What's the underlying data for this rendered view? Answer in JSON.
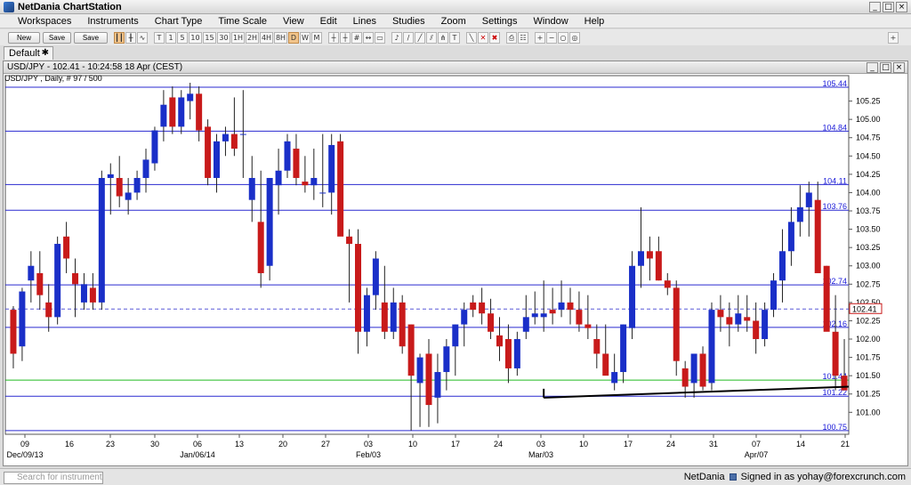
{
  "app": {
    "title": "NetDania ChartStation"
  },
  "menu": [
    "Workspaces",
    "Instruments",
    "Chart Type",
    "Time Scale",
    "View",
    "Edit",
    "Lines",
    "Studies",
    "Zoom",
    "Settings",
    "Window",
    "Help"
  ],
  "toolbar": {
    "new_label": "New",
    "save_label": "Save",
    "saveas_label": "Save as..",
    "timeframes": [
      "T",
      "1",
      "5",
      "10",
      "15",
      "30",
      "1H",
      "2H",
      "4H",
      "8H",
      "D",
      "W",
      "M"
    ],
    "active_timeframe": "D"
  },
  "tabs": [
    {
      "label": "Default"
    }
  ],
  "chart_window": {
    "header": "USD/JPY - 102.41 - 10:24:58 18 Apr (CEST)",
    "subheader": "USD/JPY , Daily, # 97 / 500"
  },
  "chart_data": {
    "type": "candlestick",
    "instrument": "USD/JPY",
    "ylim": [
      100.7,
      105.5
    ],
    "y_ticks": [
      101.0,
      101.25,
      101.5,
      101.75,
      102.0,
      102.25,
      102.5,
      102.75,
      103.0,
      103.25,
      103.5,
      103.75,
      104.0,
      104.25,
      104.5,
      104.75,
      105.0,
      105.25
    ],
    "x_tick_labels": [
      "09",
      "23",
      "30",
      "06",
      "13",
      "20",
      "27",
      "03",
      "10",
      "17",
      "24",
      "03",
      "10",
      "17",
      "24",
      "31",
      "07",
      "14",
      "21",
      "16"
    ],
    "x_period_labels": [
      "Dec/09/13",
      "Jan/06/14",
      "Feb/03",
      "Mar/03",
      "Apr/07"
    ],
    "horizontal_levels": [
      {
        "label": "105.44",
        "value": 105.44,
        "color": "#2a2ad0"
      },
      {
        "label": "104.84",
        "value": 104.84,
        "color": "#2a2ad0"
      },
      {
        "label": "104.11",
        "value": 104.11,
        "color": "#2a2ad0"
      },
      {
        "label": "103.76",
        "value": 103.76,
        "color": "#2a2ad0"
      },
      {
        "label": "102.74",
        "value": 102.74,
        "color": "#2a2ad0"
      },
      {
        "label": "102.16",
        "value": 102.16,
        "color": "#2a2ad0"
      },
      {
        "label": "101.44",
        "value": 101.44,
        "color": "#22bb22"
      },
      {
        "label": "101.22",
        "value": 101.22,
        "color": "#2a2ad0"
      },
      {
        "label": "100.75",
        "value": 100.75,
        "color": "#2a2ad0"
      }
    ],
    "current_price": {
      "label": "102.41",
      "value": 102.41
    },
    "trendline": {
      "start": {
        "index": 60,
        "value": 101.2
      },
      "end": {
        "index": 96,
        "value": 101.35
      }
    },
    "bull_color": "#1a2fc8",
    "bear_color": "#c81a1a",
    "candles": [
      [
        102.4,
        102.45,
        101.6,
        101.8
      ],
      [
        101.9,
        102.7,
        101.7,
        102.65
      ],
      [
        102.8,
        103.2,
        102.5,
        103.0
      ],
      [
        102.9,
        103.2,
        102.4,
        102.6
      ],
      [
        102.5,
        102.75,
        102.1,
        102.3
      ],
      [
        102.3,
        103.4,
        102.2,
        103.3
      ],
      [
        103.4,
        103.6,
        102.9,
        103.1
      ],
      [
        102.9,
        103.1,
        102.3,
        102.75
      ],
      [
        102.5,
        102.9,
        102.4,
        102.75
      ],
      [
        102.7,
        102.9,
        102.4,
        102.5
      ],
      [
        102.5,
        104.3,
        102.4,
        104.2
      ],
      [
        104.2,
        104.4,
        103.7,
        104.25
      ],
      [
        104.2,
        104.5,
        103.8,
        103.95
      ],
      [
        103.9,
        104.2,
        103.7,
        104.0
      ],
      [
        104.0,
        104.3,
        103.9,
        104.2
      ],
      [
        104.2,
        104.6,
        104.0,
        104.45
      ],
      [
        104.4,
        104.9,
        104.3,
        104.85
      ],
      [
        104.9,
        105.4,
        104.7,
        105.2
      ],
      [
        105.3,
        105.45,
        104.8,
        104.9
      ],
      [
        104.9,
        105.4,
        104.8,
        105.3
      ],
      [
        105.25,
        105.5,
        105.0,
        105.35
      ],
      [
        105.35,
        105.45,
        104.7,
        104.85
      ],
      [
        104.9,
        105.0,
        104.1,
        104.2
      ],
      [
        104.2,
        104.8,
        104.0,
        104.7
      ],
      [
        104.7,
        104.9,
        104.5,
        104.8
      ],
      [
        104.8,
        105.3,
        104.5,
        104.6
      ],
      [
        104.8,
        105.4,
        104.2,
        104.8
      ],
      [
        103.9,
        104.5,
        103.6,
        104.2
      ],
      [
        103.6,
        104.3,
        102.7,
        102.9
      ],
      [
        103.0,
        104.2,
        102.8,
        104.2
      ],
      [
        104.1,
        104.6,
        103.7,
        104.3
      ],
      [
        104.3,
        104.8,
        104.2,
        104.7
      ],
      [
        104.6,
        104.8,
        104.1,
        104.2
      ],
      [
        104.15,
        104.5,
        104.0,
        104.1
      ],
      [
        104.1,
        104.6,
        103.9,
        104.2
      ],
      [
        104.0,
        104.8,
        103.8,
        104.0
      ],
      [
        104.0,
        104.8,
        103.7,
        104.65
      ],
      [
        104.7,
        104.8,
        103.6,
        103.4
      ],
      [
        103.4,
        103.5,
        102.5,
        103.3
      ],
      [
        103.3,
        103.5,
        101.8,
        102.1
      ],
      [
        102.1,
        102.7,
        101.9,
        102.6
      ],
      [
        102.6,
        103.2,
        102.4,
        103.1
      ],
      [
        102.5,
        103.0,
        102.0,
        102.1
      ],
      [
        102.1,
        102.7,
        102.0,
        102.5
      ],
      [
        102.5,
        102.6,
        101.8,
        101.9
      ],
      [
        102.2,
        102.2,
        100.75,
        101.5
      ],
      [
        101.4,
        101.8,
        100.8,
        101.75
      ],
      [
        101.8,
        102.0,
        100.8,
        101.1
      ],
      [
        101.2,
        101.8,
        100.85,
        101.55
      ],
      [
        101.55,
        102.0,
        101.3,
        101.9
      ],
      [
        101.9,
        102.2,
        101.5,
        102.2
      ],
      [
        102.2,
        102.5,
        101.9,
        102.4
      ],
      [
        102.5,
        102.6,
        102.3,
        102.4
      ],
      [
        102.5,
        102.7,
        102.2,
        102.35
      ],
      [
        102.35,
        102.55,
        102.0,
        102.1
      ],
      [
        102.05,
        102.3,
        101.7,
        101.9
      ],
      [
        102.0,
        102.2,
        101.4,
        101.6
      ],
      [
        101.6,
        102.1,
        101.5,
        102.0
      ],
      [
        102.1,
        102.6,
        102.0,
        102.3
      ],
      [
        102.3,
        102.65,
        102.2,
        102.35
      ],
      [
        102.3,
        102.8,
        102.1,
        102.35
      ],
      [
        102.4,
        102.7,
        102.2,
        102.35
      ],
      [
        102.4,
        102.8,
        102.3,
        102.5
      ],
      [
        102.5,
        102.7,
        102.2,
        102.4
      ],
      [
        102.4,
        102.65,
        102.1,
        102.2
      ],
      [
        102.2,
        102.6,
        102.0,
        102.15
      ],
      [
        102.0,
        102.2,
        101.6,
        101.8
      ],
      [
        101.8,
        102.2,
        101.6,
        101.5
      ],
      [
        101.4,
        101.8,
        101.3,
        101.55
      ],
      [
        101.55,
        102.2,
        101.4,
        102.2
      ],
      [
        102.15,
        103.2,
        102.0,
        103.0
      ],
      [
        103.0,
        103.8,
        102.7,
        103.2
      ],
      [
        103.2,
        103.4,
        102.8,
        103.1
      ],
      [
        103.2,
        103.4,
        102.8,
        102.8
      ],
      [
        102.8,
        102.9,
        102.6,
        102.7
      ],
      [
        102.7,
        102.8,
        101.5,
        101.7
      ],
      [
        101.6,
        101.7,
        101.2,
        101.35
      ],
      [
        101.4,
        101.8,
        101.2,
        101.8
      ],
      [
        101.8,
        101.9,
        101.3,
        101.35
      ],
      [
        101.4,
        102.5,
        101.3,
        102.4
      ],
      [
        102.4,
        102.6,
        102.1,
        102.3
      ],
      [
        102.3,
        102.5,
        101.9,
        102.2
      ],
      [
        102.2,
        102.6,
        102.1,
        102.35
      ],
      [
        102.3,
        102.6,
        102.1,
        102.25
      ],
      [
        102.25,
        102.5,
        101.8,
        102.0
      ],
      [
        102.0,
        102.5,
        101.9,
        102.4
      ],
      [
        102.4,
        102.9,
        102.3,
        102.8
      ],
      [
        102.8,
        103.5,
        102.5,
        103.2
      ],
      [
        103.2,
        103.8,
        103.0,
        103.6
      ],
      [
        103.6,
        104.1,
        103.4,
        103.8
      ],
      [
        103.8,
        104.15,
        103.4,
        104.0
      ],
      [
        103.9,
        104.15,
        103.3,
        102.9
      ],
      [
        103.0,
        103.0,
        102.7,
        102.1
      ],
      [
        102.1,
        102.6,
        101.3,
        101.5
      ],
      [
        101.5,
        102.0,
        101.3,
        101.3
      ]
    ]
  },
  "status": {
    "search_placeholder": "Search for instrument",
    "brand": "NetDania",
    "signed_in": "Signed in as yohay@forexcrunch.com"
  }
}
